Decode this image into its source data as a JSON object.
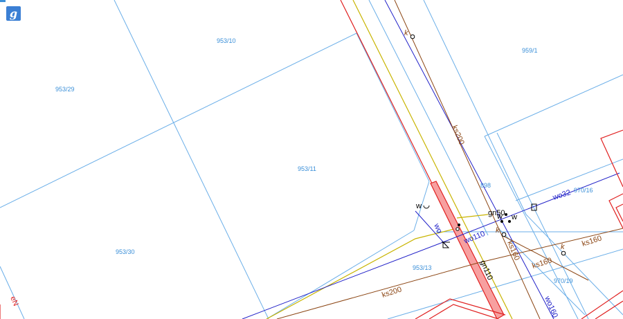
{
  "app": {
    "logo_glyph": "g",
    "logo_icon": "geoportal-logo-icon",
    "logo_color": "#3b7fd4"
  },
  "colors": {
    "parcel_line": "#6aaee8",
    "parcel_label": "#3a8fd8",
    "water": "#2020c8",
    "sewer": "#8b4513",
    "gas": "#c8b400",
    "power": "#e02020",
    "building": "#e02020"
  },
  "parcels": [
    "953/10",
    "959/1",
    "953/29",
    "953/11",
    "953/30",
    "898",
    "970/16",
    "953/13",
    "970/19"
  ],
  "utilities": {
    "ks200_upper": "ks200",
    "ks200_lower": "ks200",
    "ks160_a": "ks160",
    "ks160_b": "ks160",
    "ks160_c": "ks160",
    "wo32": "wo32",
    "wo110": "wo110",
    "wo160": "wo160",
    "wo": "wo",
    "gn50": "gn50",
    "gn110": "gn110",
    "k1": "k",
    "k2": "k",
    "k3": "k",
    "w1": "w",
    "w2": "w",
    "w3": "w",
    "en": "eN"
  }
}
